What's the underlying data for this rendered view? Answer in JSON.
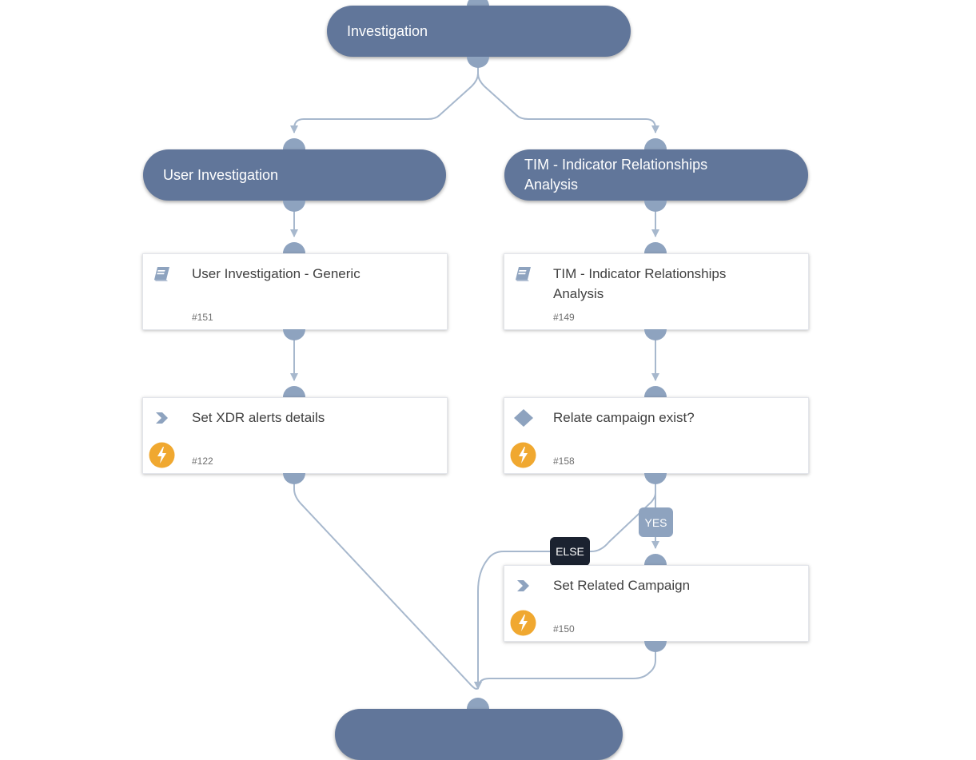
{
  "colors": {
    "section_fill": "#61769a",
    "port": "#8ea3bf",
    "edge": "#a7b8cd",
    "automation_badge": "#f0a830",
    "else_label": "#1b2230",
    "yes_label": "#8ea3bf"
  },
  "sections": {
    "investigation": {
      "title": "Investigation"
    },
    "user_investigation": {
      "title": "User Investigation"
    },
    "tim_analysis": {
      "title": "TIM - Indicator Relationships Analysis"
    }
  },
  "tasks": {
    "user_investigation_generic": {
      "title": "User Investigation - Generic",
      "id": "#151",
      "type": "playbook-icon",
      "automation": false
    },
    "tim_indicator_relationships": {
      "title": "TIM - Indicator Relationships Analysis",
      "id": "#149",
      "type": "playbook-icon",
      "automation": false
    },
    "set_xdr_alerts": {
      "title": "Set XDR alerts details",
      "id": "#122",
      "type": "action-chevron-icon",
      "automation": true
    },
    "relate_campaign_exist": {
      "title": "Relate campaign exist?",
      "id": "#158",
      "type": "condition-diamond-icon",
      "automation": true
    },
    "set_related_campaign": {
      "title": "Set Related Campaign",
      "id": "#150",
      "type": "action-chevron-icon",
      "automation": true
    }
  },
  "branch_labels": {
    "yes": "YES",
    "else": "ELSE"
  }
}
